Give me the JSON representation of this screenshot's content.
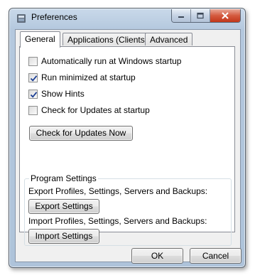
{
  "window": {
    "title": "Preferences"
  },
  "tabs": [
    {
      "label": "General",
      "active": true
    },
    {
      "label": "Applications (Clients)",
      "active": false
    },
    {
      "label": "Advanced",
      "active": false
    }
  ],
  "general": {
    "options": [
      {
        "label": "Automatically run at Windows startup",
        "checked": false
      },
      {
        "label": "Run minimized at startup",
        "checked": true
      },
      {
        "label": "Show Hints",
        "checked": true
      },
      {
        "label": "Check for Updates at startup",
        "checked": false
      }
    ],
    "check_updates_button": "Check for Updates Now",
    "program_settings": {
      "title": "Program Settings",
      "export_label": "Export Profiles, Settings, Servers and Backups:",
      "export_button": "Export Settings",
      "import_label": "Import Profiles, Settings, Servers and Backups:",
      "import_button": "Import Settings"
    }
  },
  "footer": {
    "ok": "OK",
    "cancel": "Cancel"
  },
  "colors": {
    "check_blue": "#1c3f94",
    "close_red": "#c2371b"
  }
}
